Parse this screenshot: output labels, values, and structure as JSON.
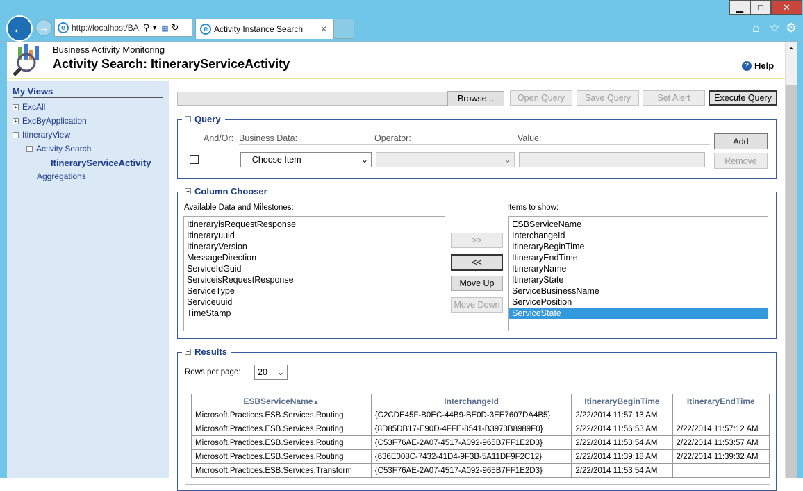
{
  "browser": {
    "address": "http://localhost/BA",
    "tab_title": "Activity Instance Search",
    "window_buttons": {
      "minimize": "▁",
      "maximize": "□",
      "close": "✕"
    }
  },
  "header": {
    "app_name": "Business Activity Monitoring",
    "page_title": "Activity Search: ItineraryServiceActivity",
    "help_label": "Help"
  },
  "sidebar": {
    "title": "My Views",
    "items": [
      "ExcAll",
      "ExcByApplication",
      "ItineraryView",
      "Activity Search",
      "ItineraryServiceActivity",
      "Aggregations"
    ]
  },
  "toolbar": {
    "browse": "Browse...",
    "open_query": "Open Query",
    "save_query": "Save Query",
    "set_alert": "Set Alert",
    "execute_query": "Execute Query"
  },
  "query": {
    "legend": "Query",
    "andor": "And/Or:",
    "business_data": "Business Data:",
    "operator": "Operator:",
    "value": "Value:",
    "choose_item": "-- Choose Item --",
    "add": "Add",
    "remove": "Remove"
  },
  "column_chooser": {
    "legend": "Column Chooser",
    "available_label": "Available Data and Milestones:",
    "items_label": "Items to show:",
    "available": [
      "ItineraryisRequestResponse",
      "Itineraryuuid",
      "ItineraryVersion",
      "MessageDirection",
      "ServiceIdGuid",
      "ServiceisRequestResponse",
      "ServiceType",
      "Serviceuuid",
      "TimeStamp"
    ],
    "shown": [
      "ESBServiceName",
      "InterchangeId",
      "ItineraryBeginTime",
      "ItineraryEndTime",
      "ItineraryName",
      "ItineraryState",
      "ServiceBusinessName",
      "ServicePosition",
      "ServiceState"
    ],
    "selected": "ServiceState",
    "add_btn": ">>",
    "remove_btn": "<<",
    "move_up": "Move Up",
    "move_down": "Move Down"
  },
  "results": {
    "legend": "Results",
    "rows_per_page_label": "Rows per page:",
    "rows_per_page": "20",
    "columns": [
      "ESBServiceName",
      "InterchangeId",
      "ItineraryBeginTime",
      "ItineraryEndTime"
    ],
    "sort_arrow": "▲",
    "rows": [
      [
        "Microsoft.Practices.ESB.Services.Routing",
        "{C2CDE45F-B0EC-44B9-BE0D-3EE7607DA4B5}",
        "2/22/2014 11:57:13 AM",
        ""
      ],
      [
        "Microsoft.Practices.ESB.Services.Routing",
        "{8D85DB17-E90D-4FFE-8541-B3973B8989F0}",
        "2/22/2014 11:56:53 AM",
        "2/22/2014 11:57:12 AM"
      ],
      [
        "Microsoft.Practices.ESB.Services.Routing",
        "{C53F76AE-2A07-4517-A092-965B7FF1E2D3}",
        "2/22/2014 11:53:54 AM",
        "2/22/2014 11:53:57 AM"
      ],
      [
        "Microsoft.Practices.ESB.Services.Routing",
        "{636E008C-7432-41D4-9F3B-5A11DF9F2C12}",
        "2/22/2014 11:39:18 AM",
        "2/22/2014 11:39:32 AM"
      ],
      [
        "Microsoft.Practices.ESB.Services.Transform",
        "{C53F76AE-2A07-4517-A092-965B7FF1E2D3}",
        "2/22/2014 11:53:54 AM",
        ""
      ]
    ]
  }
}
